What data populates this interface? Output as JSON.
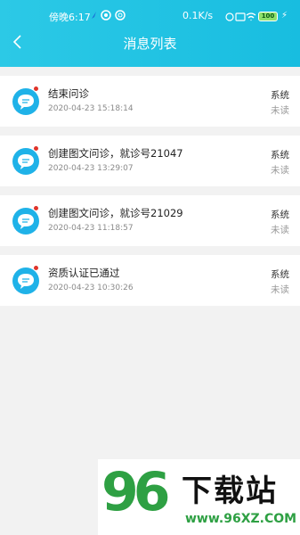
{
  "status_bar": {
    "time": "傍晚6:17",
    "speed": "0.1K/s",
    "battery": "100"
  },
  "header": {
    "title": "消息列表"
  },
  "messages": [
    {
      "title": "结束问诊",
      "time": "2020-04-23 15:18:14",
      "source": "系统",
      "status": "未读"
    },
    {
      "title": "创建图文问诊，就诊号21047",
      "time": "2020-04-23 13:29:07",
      "source": "系统",
      "status": "未读"
    },
    {
      "title": "创建图文问诊，就诊号21029",
      "time": "2020-04-23 11:18:57",
      "source": "系统",
      "status": "未读"
    },
    {
      "title": "资质认证已通过",
      "time": "2020-04-23 10:30:26",
      "source": "系统",
      "status": "未读"
    }
  ],
  "watermark": {
    "number": "96",
    "text": "下载站",
    "url": "www.96XZ.COM"
  },
  "colors": {
    "header": "#18bde0",
    "avatar": "#1fb2e8",
    "unread_dot": "#e0352b",
    "watermark_green": "#2ea043"
  }
}
